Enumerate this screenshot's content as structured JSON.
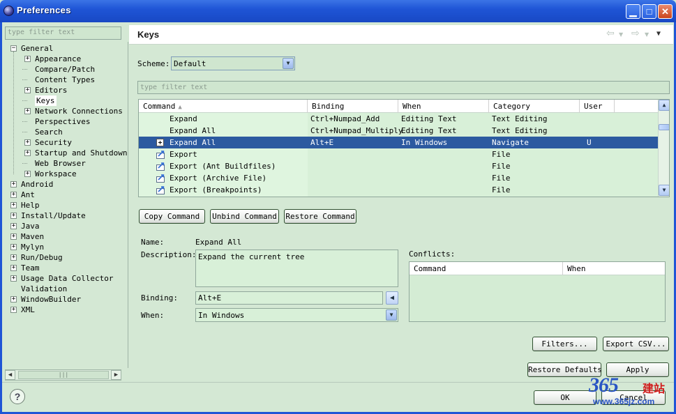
{
  "window": {
    "title": "Preferences"
  },
  "left": {
    "filter_placeholder": "type filter text",
    "tree": [
      {
        "label": "General",
        "level": 0,
        "exp": "−"
      },
      {
        "label": "Appearance",
        "level": 1,
        "exp": "+"
      },
      {
        "label": "Compare/Patch",
        "level": 1,
        "exp": ""
      },
      {
        "label": "Content Types",
        "level": 1,
        "exp": ""
      },
      {
        "label": "Editors",
        "level": 1,
        "exp": "+"
      },
      {
        "label": "Keys",
        "level": 1,
        "exp": "",
        "selected": true
      },
      {
        "label": "Network Connections",
        "level": 1,
        "exp": "+"
      },
      {
        "label": "Perspectives",
        "level": 1,
        "exp": ""
      },
      {
        "label": "Search",
        "level": 1,
        "exp": ""
      },
      {
        "label": "Security",
        "level": 1,
        "exp": "+"
      },
      {
        "label": "Startup and Shutdown",
        "level": 1,
        "exp": "+"
      },
      {
        "label": "Web Browser",
        "level": 1,
        "exp": ""
      },
      {
        "label": "Workspace",
        "level": 1,
        "exp": "+"
      },
      {
        "label": "Android",
        "level": 0,
        "exp": "+"
      },
      {
        "label": "Ant",
        "level": 0,
        "exp": "+"
      },
      {
        "label": "Help",
        "level": 0,
        "exp": "+"
      },
      {
        "label": "Install/Update",
        "level": 0,
        "exp": "+"
      },
      {
        "label": "Java",
        "level": 0,
        "exp": "+"
      },
      {
        "label": "Maven",
        "level": 0,
        "exp": "+"
      },
      {
        "label": "Mylyn",
        "level": 0,
        "exp": "+"
      },
      {
        "label": "Run/Debug",
        "level": 0,
        "exp": "+"
      },
      {
        "label": "Team",
        "level": 0,
        "exp": "+"
      },
      {
        "label": "Usage Data Collector",
        "level": 0,
        "exp": "+"
      },
      {
        "label": "Validation",
        "level": 0,
        "exp": ""
      },
      {
        "label": "WindowBuilder",
        "level": 0,
        "exp": "+"
      },
      {
        "label": "XML",
        "level": 0,
        "exp": "+"
      }
    ]
  },
  "page": {
    "title": "Keys"
  },
  "scheme": {
    "label": "Scheme:",
    "value": "Default"
  },
  "table": {
    "filter_placeholder": "type filter text",
    "columns": [
      "Command",
      "Binding",
      "When",
      "Category",
      "User"
    ],
    "rows": [
      {
        "command": "Expand",
        "binding": "Ctrl+Numpad_Add",
        "when": "Editing Text",
        "category": "Text Editing",
        "user": "",
        "icon": ""
      },
      {
        "command": "Expand All",
        "binding": "Ctrl+Numpad_Multiply",
        "when": "Editing Text",
        "category": "Text Editing",
        "user": "",
        "icon": ""
      },
      {
        "command": "Expand All",
        "binding": "Alt+E",
        "when": "In Windows",
        "category": "Navigate",
        "user": "U",
        "icon": "expand",
        "selected": true
      },
      {
        "command": "Export",
        "binding": "",
        "when": "",
        "category": "File",
        "user": "",
        "icon": "export"
      },
      {
        "command": "Export (Ant Buildfiles)",
        "binding": "",
        "when": "",
        "category": "File",
        "user": "",
        "icon": "export"
      },
      {
        "command": "Export (Archive File)",
        "binding": "",
        "when": "",
        "category": "File",
        "user": "",
        "icon": "export"
      },
      {
        "command": "Export (Breakpoints)",
        "binding": "",
        "when": "",
        "category": "File",
        "user": "",
        "icon": "export"
      }
    ]
  },
  "buttons": {
    "copy": "Copy Command",
    "unbind": "Unbind Command",
    "restore": "Restore Command",
    "filters": "Filters...",
    "export_csv": "Export CSV...",
    "restore_defaults": "Restore Defaults",
    "apply": "Apply",
    "ok": "OK",
    "cancel": "Cancel"
  },
  "details": {
    "name_label": "Name:",
    "name_value": "Expand All",
    "description_label": "Description:",
    "description_value": "Expand the current tree",
    "binding_label": "Binding:",
    "binding_value": "Alt+E",
    "when_label": "When:",
    "when_value": "In Windows"
  },
  "conflicts": {
    "label": "Conflicts:",
    "columns": [
      "Command",
      "When"
    ]
  },
  "watermark": {
    "number": "365",
    "cn": "建站",
    "url": "www.365jz.com"
  }
}
